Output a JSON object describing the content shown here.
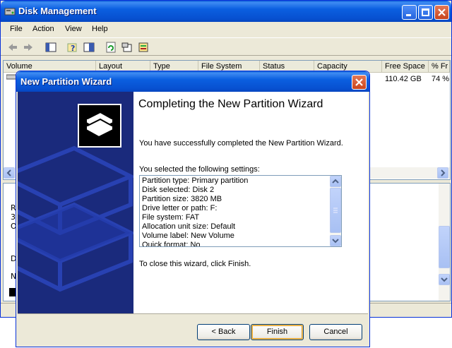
{
  "main_window": {
    "title": "Disk Management",
    "menu": [
      "File",
      "Action",
      "View",
      "Help"
    ],
    "columns": [
      "Volume",
      "Layout",
      "Type",
      "File System",
      "Status",
      "Capacity",
      "Free Space",
      "% Fr"
    ],
    "row": {
      "free_space": "110.42 GB",
      "percent_free": "74 %"
    },
    "graph_fragments": [
      "R",
      "3",
      "O",
      "D",
      "N"
    ]
  },
  "wizard": {
    "title": "New Partition Wizard",
    "heading": "Completing the New Partition Wizard",
    "success_text": "You have successfully completed the New Partition Wizard.",
    "settings_label": "You selected the following settings:",
    "settings": [
      "Partition type: Primary partition",
      "Disk selected: Disk 2",
      "Partition size: 3820 MB",
      "Drive letter or path: F:",
      "File system: FAT",
      "Allocation unit size: Default",
      "Volume label: New Volume",
      "Quick format: No"
    ],
    "close_hint": "To close this wizard, click Finish.",
    "buttons": {
      "back": "< Back",
      "finish": "Finish",
      "cancel": "Cancel"
    }
  },
  "colors": {
    "titlebar": "#0b5fe0",
    "window_bg": "#ece9d8",
    "banner": "#1a2a7c",
    "close_button": "#c8441c"
  },
  "icons": [
    "disk-management-app-icon",
    "back-arrow-icon",
    "forward-arrow-icon",
    "console-tree-icon",
    "help-icon",
    "properties-icon",
    "refresh-icon",
    "export-icon",
    "settings-icon",
    "minimize-icon",
    "maximize-icon",
    "close-icon",
    "disk-stack-icon"
  ]
}
